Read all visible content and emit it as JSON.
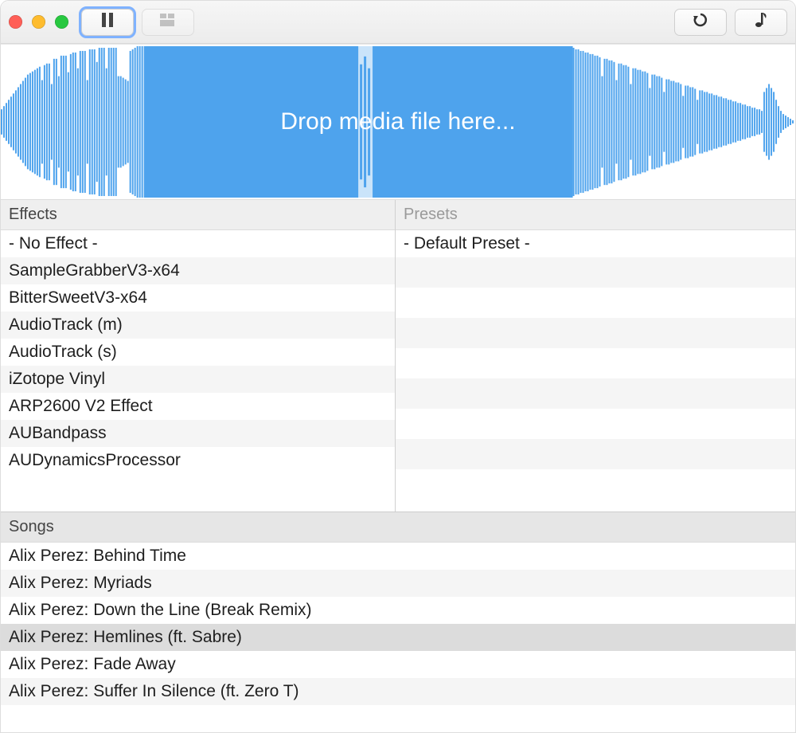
{
  "waveform": {
    "dropzone_text": "Drop media file here...",
    "fill": "#4ea3ed"
  },
  "effects": {
    "header": "Effects",
    "items": [
      "- No Effect -",
      "SampleGrabberV3-x64",
      "BitterSweetV3-x64",
      "AudioTrack (m)",
      "AudioTrack (s)",
      "iZotope Vinyl",
      "ARP2600 V2 Effect",
      "AUBandpass",
      "AUDynamicsProcessor"
    ]
  },
  "presets": {
    "header": "Presets",
    "items": [
      "- Default Preset -"
    ],
    "visible_rows": 9
  },
  "songs": {
    "header": "Songs",
    "items": [
      {
        "label": "Alix Perez: Behind Time",
        "selected": false
      },
      {
        "label": "Alix Perez: Myriads",
        "selected": false
      },
      {
        "label": "Alix Perez: Down the Line (Break Remix)",
        "selected": false
      },
      {
        "label": "Alix Perez: Hemlines (ft. Sabre)",
        "selected": true
      },
      {
        "label": "Alix Perez: Fade Away",
        "selected": false
      },
      {
        "label": "Alix Perez: Suffer In Silence (ft. Zero T)",
        "selected": false
      }
    ]
  }
}
